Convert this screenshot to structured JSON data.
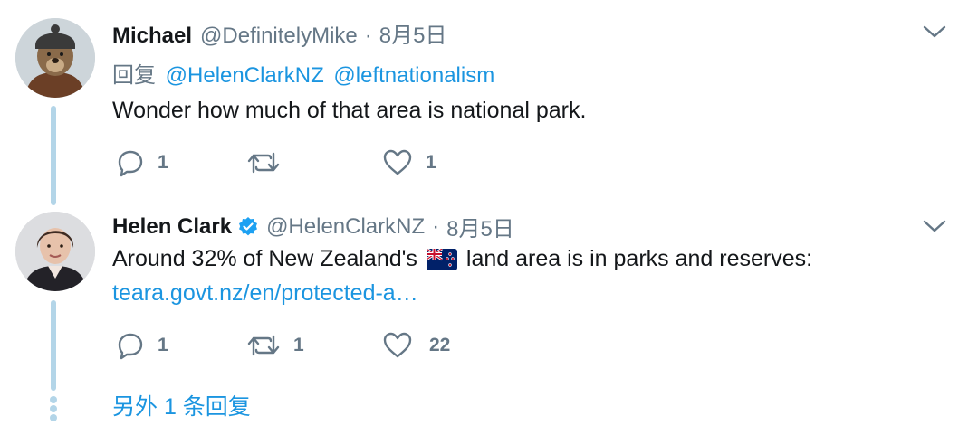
{
  "tweet1": {
    "name": "Michael",
    "handle": "@DefinitelyMike",
    "separator": "·",
    "date": "8月5日",
    "reply_prefix": "回复",
    "reply_to": [
      "@HelenClarkNZ",
      "@leftnationalism"
    ],
    "text": "Wonder how much of that area is national park.",
    "reply_count": "1",
    "retweet_count": "",
    "like_count": "1"
  },
  "tweet2": {
    "name": "Helen Clark",
    "verified": true,
    "handle": "@HelenClarkNZ",
    "separator": "·",
    "date": "8月5日",
    "text_before_flag": "Around 32% of New Zealand's",
    "flag_icon": "new-zealand-flag-emoji",
    "text_after_flag": "land area is in parks and reserves:",
    "link": "teara.govt.nz/en/protected-a…",
    "reply_count": "1",
    "retweet_count": "1",
    "like_count": "22"
  },
  "more_replies": "另外 1 条回复",
  "colors": {
    "link": "#1b95e0",
    "secondary_text": "#657786",
    "thread_line": "#b3d5e8",
    "verified": "#1da1f2",
    "icon": "#657786"
  }
}
